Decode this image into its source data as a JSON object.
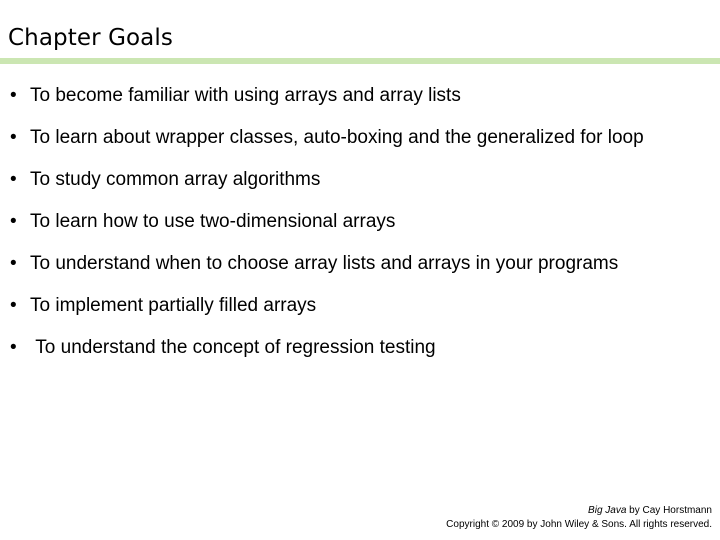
{
  "slide": {
    "title": "Chapter Goals",
    "accent_color": "#cbe6b2",
    "background_color": "#ffffff",
    "text_color": "#000000",
    "bullet_glyph": "•",
    "goals": [
      {
        "text": "To become familiar with using arrays and array lists"
      },
      {
        "text": "To learn about wrapper classes, auto-boxing and the generalized for loop"
      },
      {
        "text": "To study common array algorithms"
      },
      {
        "text": "To learn how to use two-dimensional arrays"
      },
      {
        "text": "To understand when to choose array lists and arrays in your programs"
      },
      {
        "text": "To implement partially filled arrays"
      },
      {
        "text": " To understand the concept of regression testing"
      }
    ]
  },
  "footer": {
    "book_title": "Big Java",
    "byline": " by Cay Horstmann",
    "copyright": "Copyright © 2009 by John Wiley & Sons.  All rights reserved."
  }
}
